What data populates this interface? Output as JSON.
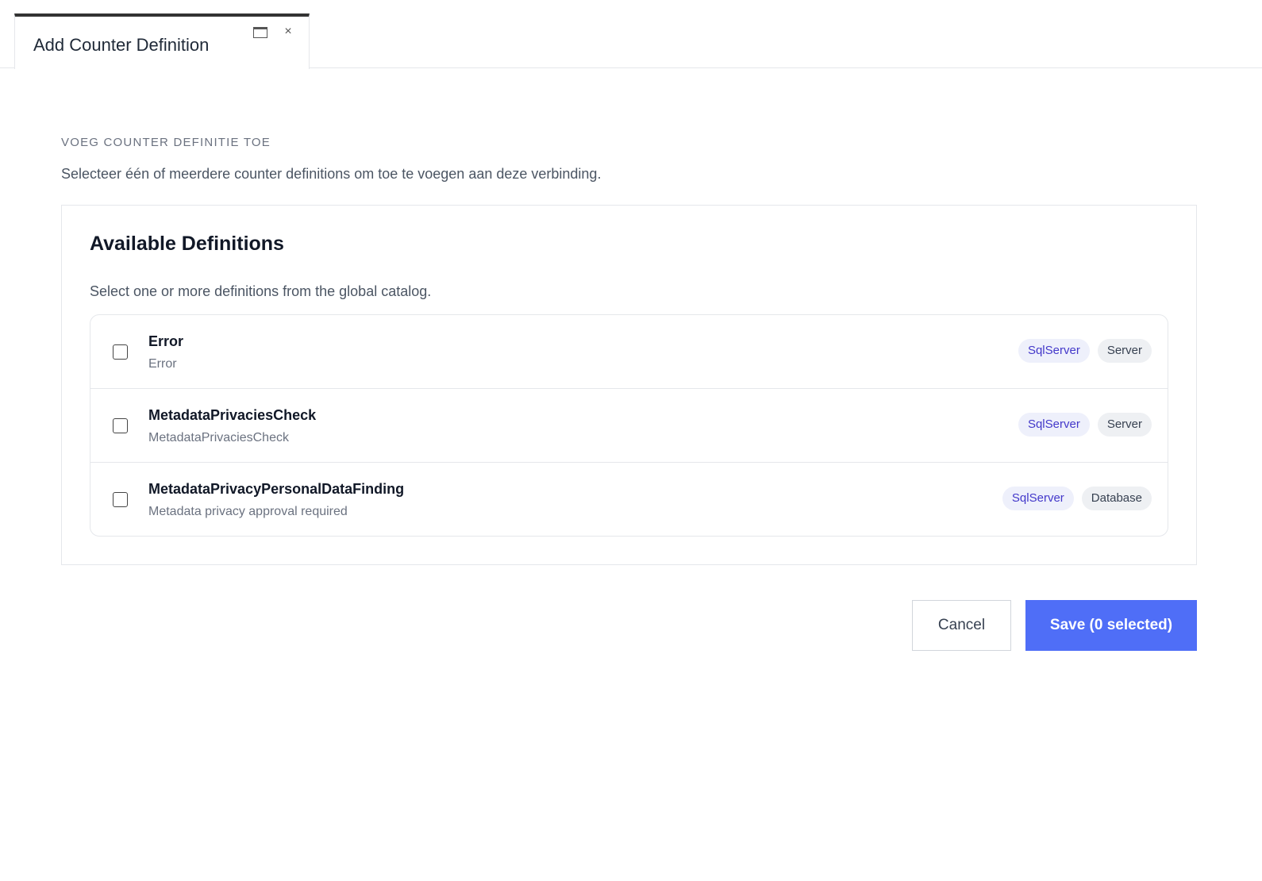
{
  "tab": {
    "title": "Add Counter Definition",
    "window_icon": "window-icon",
    "close_icon": "close-icon",
    "close_glyph": "×"
  },
  "section": {
    "heading": "VOEG COUNTER DEFINITIE TOE",
    "description": "Selecteer één of meerdere counter definitions om toe te voegen aan deze verbinding."
  },
  "panel": {
    "title": "Available Definitions",
    "description": "Select one or more definitions from the global catalog."
  },
  "definitions": [
    {
      "name": "Error",
      "description": "Error",
      "checked": false,
      "tags": [
        "SqlServer",
        "Server"
      ]
    },
    {
      "name": "MetadataPrivaciesCheck",
      "description": "MetadataPrivaciesCheck",
      "checked": false,
      "tags": [
        "SqlServer",
        "Server"
      ]
    },
    {
      "name": "MetadataPrivacyPersonalDataFinding",
      "description": "Metadata privacy approval required",
      "checked": false,
      "tags": [
        "SqlServer",
        "Database"
      ]
    }
  ],
  "buttons": {
    "cancel": "Cancel",
    "save": "Save (0 selected)"
  },
  "colors": {
    "accent": "#4f6ef7",
    "tag_tech_bg": "#eef0fb",
    "tag_tech_text": "#4338ca",
    "tag_scope_bg": "#eef0f3"
  }
}
